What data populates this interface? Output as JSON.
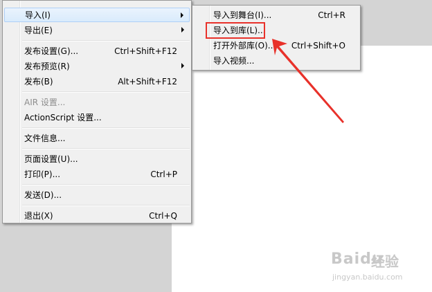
{
  "menu": {
    "items": [
      {
        "label": "导入(I)",
        "shortcut": "",
        "submenu": true,
        "highlighted": true
      },
      {
        "label": "导出(E)",
        "shortcut": "",
        "submenu": true
      },
      {
        "label": "发布设置(G)...",
        "shortcut": "Ctrl+Shift+F12"
      },
      {
        "label": "发布预览(R)",
        "shortcut": "",
        "submenu": true
      },
      {
        "label": "发布(B)",
        "shortcut": "Alt+Shift+F12"
      },
      {
        "label": "AIR 设置...",
        "shortcut": "",
        "disabled": true
      },
      {
        "label": "ActionScript 设置...",
        "shortcut": ""
      },
      {
        "label": "文件信息...",
        "shortcut": ""
      },
      {
        "label": "页面设置(U)...",
        "shortcut": ""
      },
      {
        "label": "打印(P)...",
        "shortcut": "Ctrl+P"
      },
      {
        "label": "发送(D)...",
        "shortcut": ""
      },
      {
        "label": "退出(X)",
        "shortcut": "Ctrl+Q"
      }
    ]
  },
  "submenu": {
    "items": [
      {
        "label": "导入到舞台(I)...",
        "shortcut": "Ctrl+R"
      },
      {
        "label": "导入到库(L)...",
        "shortcut": "",
        "annotated": true
      },
      {
        "label": "打开外部库(O)...",
        "shortcut": "Ctrl+Shift+O"
      },
      {
        "label": "导入视频...",
        "shortcut": ""
      }
    ]
  },
  "annotation": {
    "color": "#e8312a"
  },
  "watermark": {
    "brand": "Baidu",
    "brand_cn": "经验",
    "url": "jingyan.baidu.com"
  }
}
